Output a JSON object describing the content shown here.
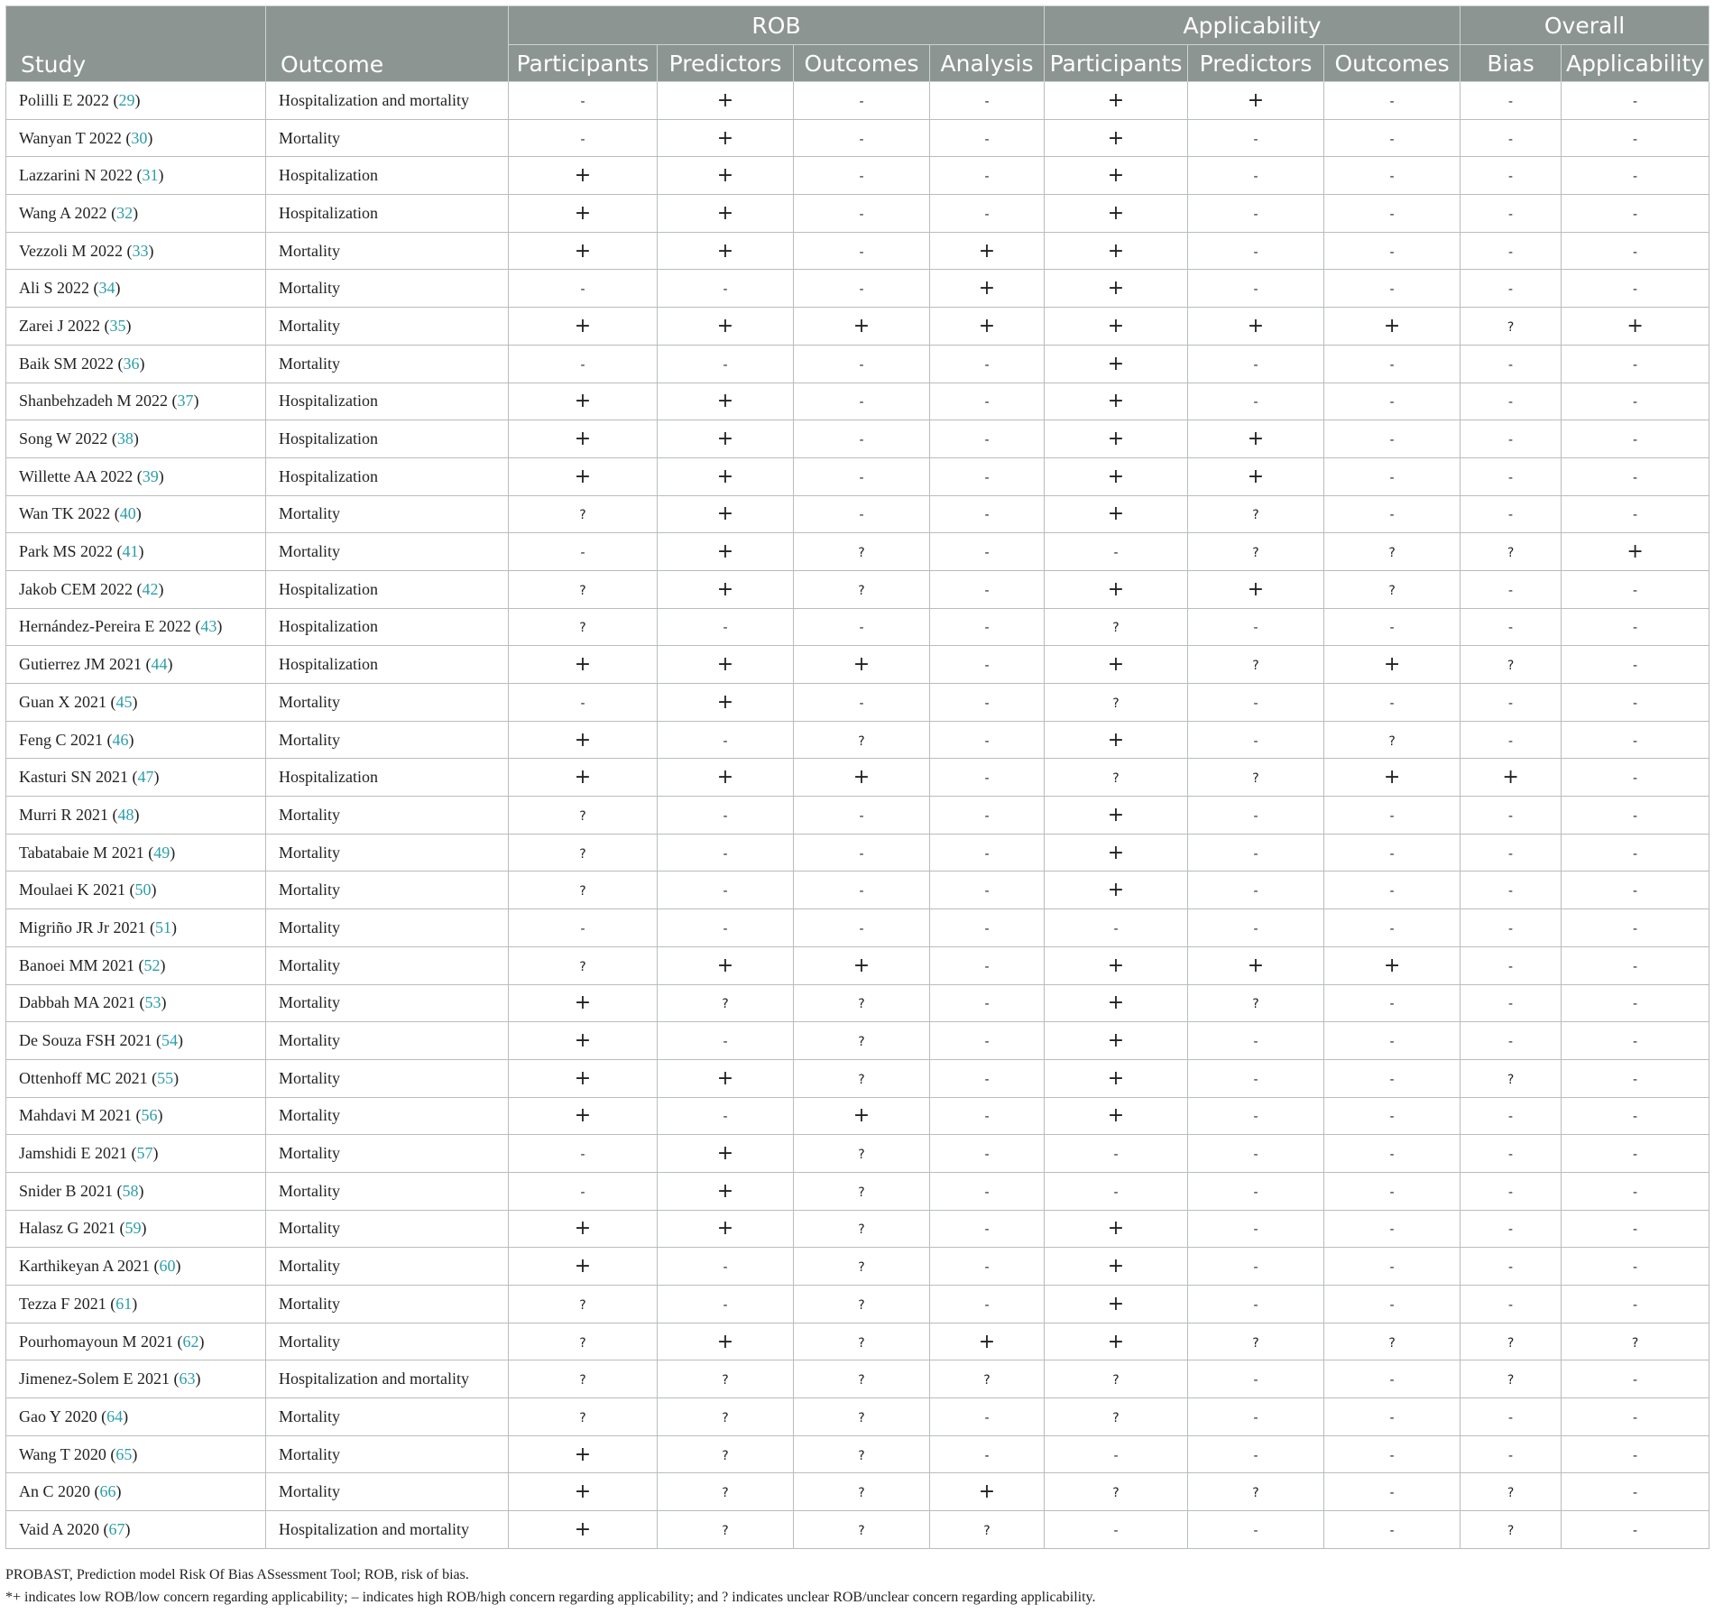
{
  "header": {
    "study": "Study",
    "outcome": "Outcome",
    "groups": [
      "ROB",
      "Applicability",
      "Overall"
    ],
    "subcolumns": [
      "Participants",
      "Predictors",
      "Outcomes",
      "Analysis",
      "Participants",
      "Predictors",
      "Outcomes",
      "Bias",
      "Applicability"
    ]
  },
  "rows": [
    {
      "study": "Polilli E 2022",
      "ref": "29",
      "outcome": "Hospitalization and mortality",
      "values": [
        "-",
        "+",
        "-",
        "-",
        "+",
        "+",
        "-",
        "-",
        "-"
      ]
    },
    {
      "study": "Wanyan T 2022",
      "ref": "30",
      "outcome": "Mortality",
      "values": [
        "-",
        "+",
        "-",
        "-",
        "+",
        "-",
        "-",
        "-",
        "-"
      ]
    },
    {
      "study": "Lazzarini N 2022",
      "ref": "31",
      "outcome": "Hospitalization",
      "values": [
        "+",
        "+",
        "-",
        "-",
        "+",
        "-",
        "-",
        "-",
        "-"
      ]
    },
    {
      "study": "Wang A 2022",
      "ref": "32",
      "outcome": "Hospitalization",
      "values": [
        "+",
        "+",
        "-",
        "-",
        "+",
        "-",
        "-",
        "-",
        "-"
      ]
    },
    {
      "study": "Vezzoli M 2022",
      "ref": "33",
      "outcome": "Mortality",
      "values": [
        "+",
        "+",
        "-",
        "+",
        "+",
        "-",
        "-",
        "-",
        "-"
      ]
    },
    {
      "study": "Ali S 2022",
      "ref": "34",
      "outcome": "Mortality",
      "values": [
        "-",
        "-",
        "-",
        "+",
        "+",
        "-",
        "-",
        "-",
        "-"
      ]
    },
    {
      "study": "Zarei J 2022",
      "ref": "35",
      "outcome": "Mortality",
      "values": [
        "+",
        "+",
        "+",
        "+",
        "+",
        "+",
        "+",
        "?",
        "+"
      ]
    },
    {
      "study": "Baik SM 2022",
      "ref": "36",
      "outcome": "Mortality",
      "values": [
        "-",
        "-",
        "-",
        "-",
        "+",
        "-",
        "-",
        "-",
        "-"
      ]
    },
    {
      "study": "Shanbehzadeh M 2022",
      "ref": "37",
      "outcome": "Hospitalization",
      "values": [
        "+",
        "+",
        "-",
        "-",
        "+",
        "-",
        "-",
        "-",
        "-"
      ]
    },
    {
      "study": "Song W 2022",
      "ref": "38",
      "outcome": "Hospitalization",
      "values": [
        "+",
        "+",
        "-",
        "-",
        "+",
        "+",
        "-",
        "-",
        "-"
      ]
    },
    {
      "study": "Willette AA 2022",
      "ref": "39",
      "outcome": "Hospitalization",
      "values": [
        "+",
        "+",
        "-",
        "-",
        "+",
        "+",
        "-",
        "-",
        "-"
      ]
    },
    {
      "study": "Wan TK 2022",
      "ref": "40",
      "outcome": "Mortality",
      "values": [
        "?",
        "+",
        "-",
        "-",
        "+",
        "?",
        "-",
        "-",
        "-"
      ]
    },
    {
      "study": "Park MS 2022",
      "ref": "41",
      "outcome": "Mortality",
      "values": [
        "-",
        "+",
        "?",
        "-",
        "-",
        "?",
        "?",
        "?",
        "+"
      ]
    },
    {
      "study": "Jakob CEM 2022",
      "ref": "42",
      "outcome": "Hospitalization",
      "values": [
        "?",
        "+",
        "?",
        "-",
        "+",
        "+",
        "?",
        "-",
        "-"
      ]
    },
    {
      "study": "Hernández-Pereira E 2022",
      "ref": "43",
      "outcome": "Hospitalization",
      "values": [
        "?",
        "-",
        "-",
        "-",
        "?",
        "-",
        "-",
        "-",
        "-"
      ]
    },
    {
      "study": "Gutierrez JM 2021",
      "ref": "44",
      "outcome": "Hospitalization",
      "values": [
        "+",
        "+",
        "+",
        "-",
        "+",
        "?",
        "+",
        "?",
        "-"
      ]
    },
    {
      "study": "Guan X 2021",
      "ref": "45",
      "outcome": "Mortality",
      "values": [
        "-",
        "+",
        "-",
        "-",
        "?",
        "-",
        "-",
        "-",
        "-"
      ]
    },
    {
      "study": "Feng C 2021",
      "ref": "46",
      "outcome": "Mortality",
      "values": [
        "+",
        "-",
        "?",
        "-",
        "+",
        "-",
        "?",
        "-",
        "-"
      ]
    },
    {
      "study": "Kasturi SN 2021",
      "ref": "47",
      "outcome": "Hospitalization",
      "values": [
        "+",
        "+",
        "+",
        "-",
        "?",
        "?",
        "+",
        "+",
        "-"
      ]
    },
    {
      "study": "Murri R 2021",
      "ref": "48",
      "outcome": "Mortality",
      "values": [
        "?",
        "-",
        "-",
        "-",
        "+",
        "-",
        "-",
        "-",
        "-"
      ]
    },
    {
      "study": "Tabatabaie M 2021",
      "ref": "49",
      "outcome": "Mortality",
      "values": [
        "?",
        "-",
        "-",
        "-",
        "+",
        "-",
        "-",
        "-",
        "-"
      ]
    },
    {
      "study": "Moulaei K 2021",
      "ref": "50",
      "outcome": "Mortality",
      "values": [
        "?",
        "-",
        "-",
        "-",
        "+",
        "-",
        "-",
        "-",
        "-"
      ]
    },
    {
      "study": "Migriño JR Jr 2021",
      "ref": "51",
      "outcome": "Mortality",
      "values": [
        "-",
        "-",
        "-",
        "-",
        "-",
        "-",
        "-",
        "-",
        "-"
      ]
    },
    {
      "study": "Banoei MM 2021",
      "ref": "52",
      "outcome": "Mortality",
      "values": [
        "?",
        "+",
        "+",
        "-",
        "+",
        "+",
        "+",
        "-",
        "-"
      ]
    },
    {
      "study": "Dabbah MA 2021",
      "ref": "53",
      "outcome": "Mortality",
      "values": [
        "+",
        "?",
        "?",
        "-",
        "+",
        "?",
        "-",
        "-",
        "-"
      ]
    },
    {
      "study": "De Souza FSH 2021",
      "ref": "54",
      "outcome": "Mortality",
      "values": [
        "+",
        "-",
        "?",
        "-",
        "+",
        "-",
        "-",
        "-",
        "-"
      ]
    },
    {
      "study": "Ottenhoff MC 2021",
      "ref": "55",
      "outcome": "Mortality",
      "values": [
        "+",
        "+",
        "?",
        "-",
        "+",
        "-",
        "-",
        "?",
        "-"
      ]
    },
    {
      "study": "Mahdavi M 2021",
      "ref": "56",
      "outcome": "Mortality",
      "values": [
        "+",
        "-",
        "+",
        "-",
        "+",
        "-",
        "-",
        "-",
        "-"
      ]
    },
    {
      "study": "Jamshidi E 2021",
      "ref": "57",
      "outcome": "Mortality",
      "values": [
        "-",
        "+",
        "?",
        "-",
        "-",
        "-",
        "-",
        "-",
        "-"
      ]
    },
    {
      "study": "Snider B 2021",
      "ref": "58",
      "outcome": "Mortality",
      "values": [
        "-",
        "+",
        "?",
        "-",
        "-",
        "-",
        "-",
        "-",
        "-"
      ]
    },
    {
      "study": "Halasz G 2021",
      "ref": "59",
      "outcome": "Mortality",
      "values": [
        "+",
        "+",
        "?",
        "-",
        "+",
        "-",
        "-",
        "-",
        "-"
      ]
    },
    {
      "study": "Karthikeyan A 2021",
      "ref": "60",
      "outcome": "Mortality",
      "values": [
        "+",
        "-",
        "?",
        "-",
        "+",
        "-",
        "-",
        "-",
        "-"
      ]
    },
    {
      "study": "Tezza F 2021",
      "ref": "61",
      "outcome": "Mortality",
      "values": [
        "?",
        "-",
        "?",
        "-",
        "+",
        "-",
        "-",
        "-",
        "-"
      ]
    },
    {
      "study": "Pourhomayoun M 2021",
      "ref": "62",
      "outcome": "Mortality",
      "values": [
        "?",
        "+",
        "?",
        "+",
        "+",
        "?",
        "?",
        "?",
        "?"
      ]
    },
    {
      "study": "Jimenez-Solem E 2021",
      "ref": "63",
      "outcome": "Hospitalization and mortality",
      "values": [
        "?",
        "?",
        "?",
        "?",
        "?",
        "-",
        "-",
        "?",
        "-"
      ]
    },
    {
      "study": "Gao Y 2020",
      "ref": "64",
      "outcome": "Mortality",
      "values": [
        "?",
        "?",
        "?",
        "-",
        "?",
        "-",
        "-",
        "-",
        "-"
      ]
    },
    {
      "study": "Wang T 2020",
      "ref": "65",
      "outcome": "Mortality",
      "values": [
        "+",
        "?",
        "?",
        "-",
        "-",
        "-",
        "-",
        "-",
        "-"
      ]
    },
    {
      "study": "An C 2020",
      "ref": "66",
      "outcome": "Mortality",
      "values": [
        "+",
        "?",
        "?",
        "+",
        "?",
        "?",
        "-",
        "?",
        "-"
      ]
    },
    {
      "study": "Vaid A 2020",
      "ref": "67",
      "outcome": "Hospitalization and mortality",
      "values": [
        "+",
        "?",
        "?",
        "?",
        "-",
        "-",
        "-",
        "?",
        "-"
      ]
    }
  ],
  "footer": {
    "line1": "PROBAST, Prediction model Risk Of Bias ASsessment Tool; ROB, risk of bias.",
    "line2": "*+ indicates low ROB/low concern regarding applicability; – indicates high ROB/high concern regarding applicability; and ? indicates unclear ROB/unclear concern regarding applicability."
  }
}
